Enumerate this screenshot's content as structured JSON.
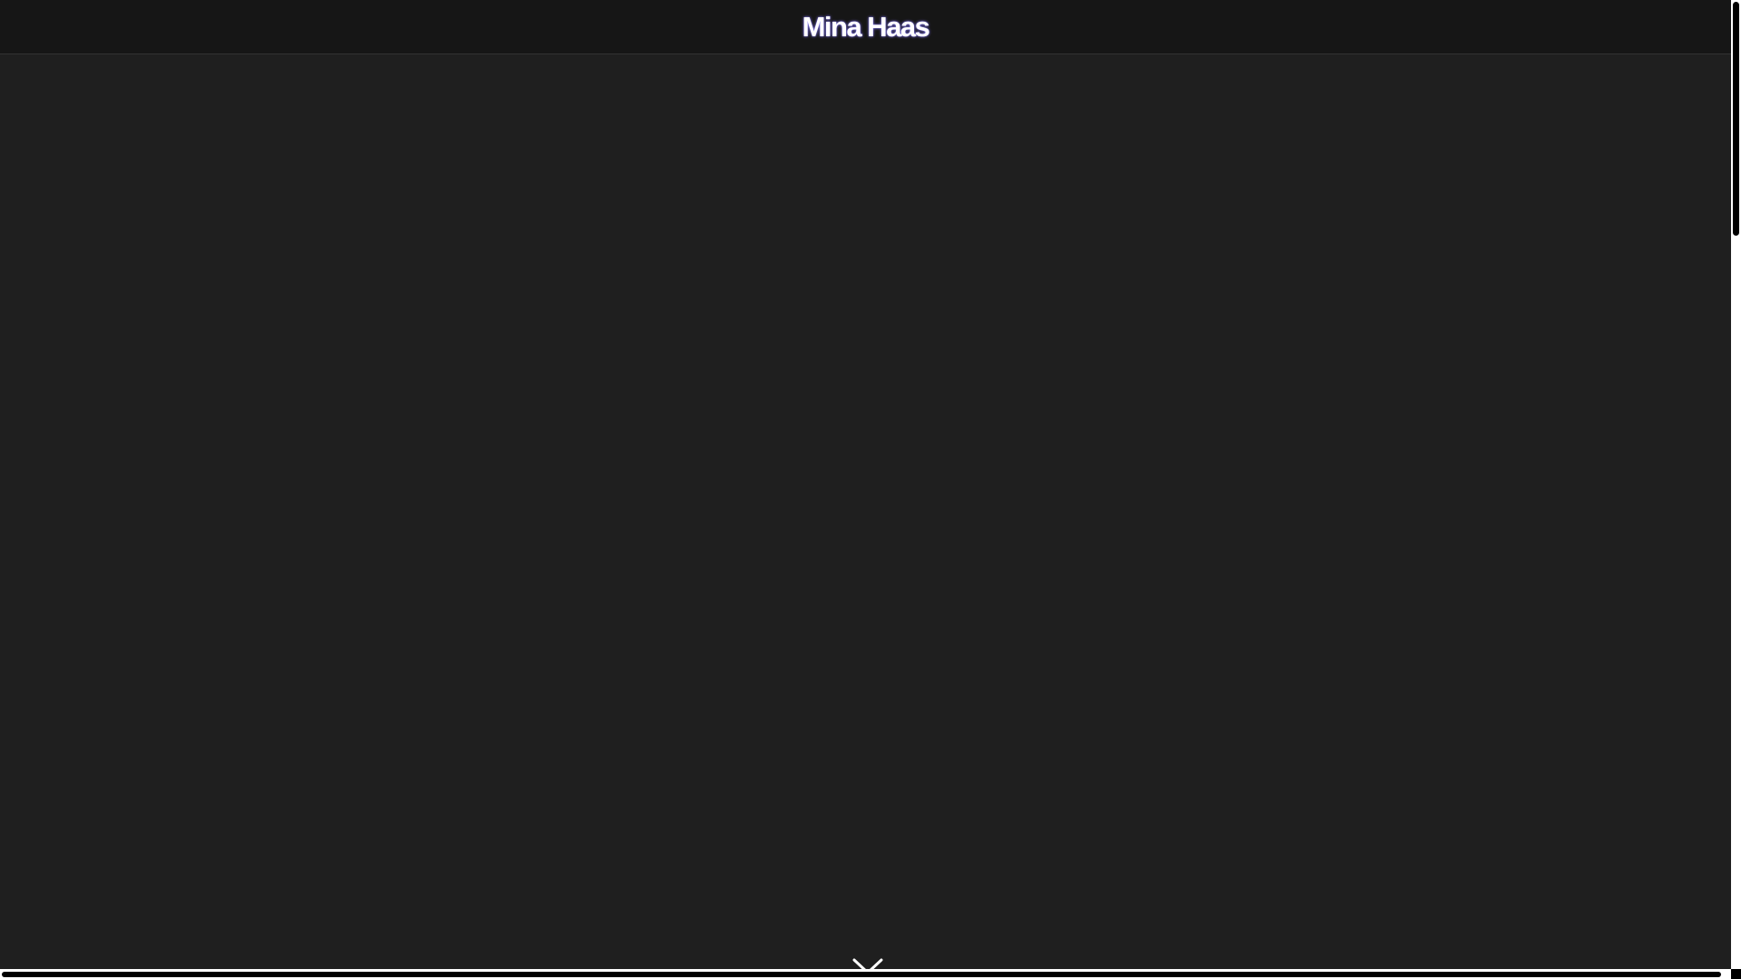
{
  "header": {
    "site_title": "Mina Haas"
  },
  "scroll_indicator": {
    "icon": "chevron-down-icon"
  },
  "colors": {
    "page_background": "#1f1f1f",
    "header_background": "#161616",
    "title_text": "#ffffff",
    "title_glow": "#8a7dff"
  }
}
